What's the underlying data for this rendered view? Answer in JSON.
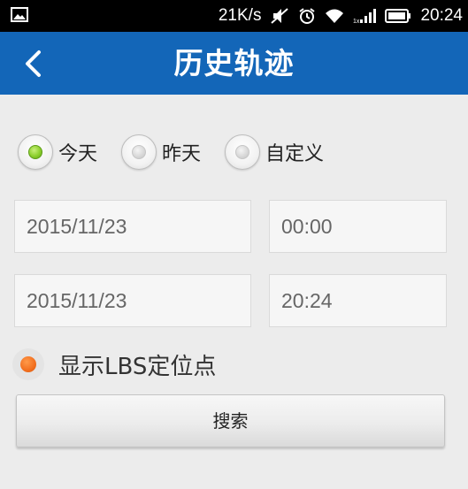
{
  "status_bar": {
    "network_speed": "21K/s",
    "time": "20:24",
    "left_icon": "image-notification-icon",
    "icons": [
      "mute-icon",
      "alarm-icon",
      "wifi-icon",
      "signal-icon",
      "battery-icon"
    ]
  },
  "header": {
    "title": "历史轨迹",
    "back_icon": "chevron-left-icon"
  },
  "period_options": [
    {
      "label": "今天",
      "selected": true
    },
    {
      "label": "昨天",
      "selected": false
    },
    {
      "label": "自定义",
      "selected": false
    }
  ],
  "start": {
    "date": "2015/11/23",
    "time": "00:00"
  },
  "end": {
    "date": "2015/11/23",
    "time": "20:24"
  },
  "lbs": {
    "label": "显示LBS定位点",
    "enabled": true
  },
  "search": {
    "label": "搜索"
  },
  "colors": {
    "header_bg": "#1366b8",
    "status_bar_bg": "#000000",
    "page_bg": "#ececec",
    "radio_selected": "#8ccf2c",
    "lbs_dot": "#f26f1f"
  }
}
